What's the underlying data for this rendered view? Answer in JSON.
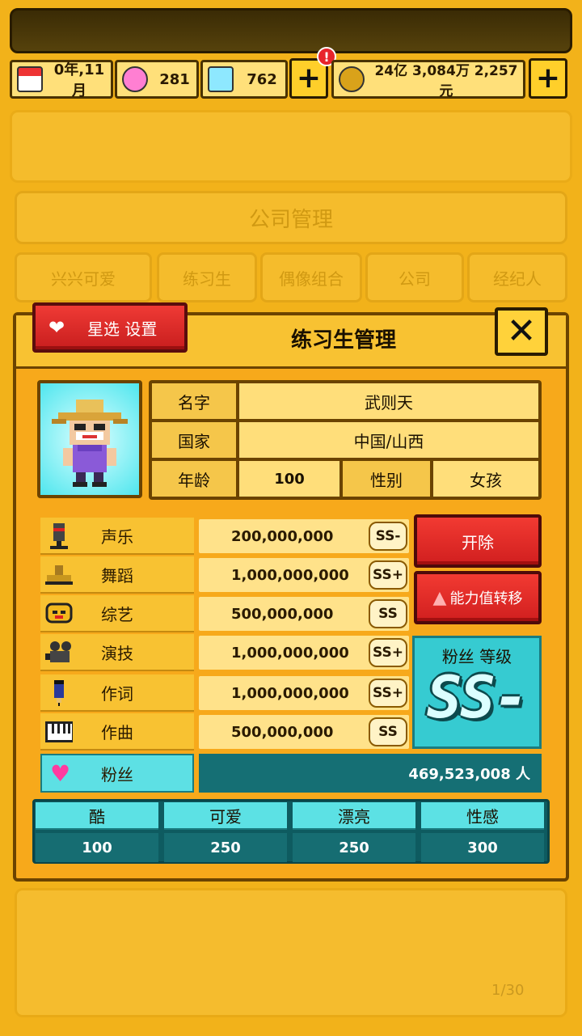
{
  "resources": {
    "date": "0年,11月",
    "pink_gems": "281",
    "diamonds": "762",
    "money": "24亿 3,084万 2,257元",
    "notification_mark": "!"
  },
  "icons": {
    "plus": "+",
    "close": "✕",
    "heart": "❤",
    "transfer": "▲",
    "fans": "♥"
  },
  "background": {
    "screen_title": "公司管理",
    "tabs": [
      "兴兴可爱",
      "练习生",
      "偶像组合",
      "公司",
      "经纪人"
    ],
    "page_indicator": "1/30"
  },
  "panel": {
    "title": "练习生管理",
    "star_button_label": "星选 设置"
  },
  "trainee": {
    "name_label": "名字",
    "name": "武则天",
    "country_label": "国家",
    "country": "中国/山西",
    "age_label": "年龄",
    "age": "100",
    "gender_label": "性别",
    "gender": "女孩"
  },
  "stats": [
    {
      "name": "声乐",
      "value": "200,000,000",
      "grade": "SS-",
      "icon": "mic-icon"
    },
    {
      "name": "舞蹈",
      "value": "1,000,000,000",
      "grade": "SS+",
      "icon": "shoe-icon"
    },
    {
      "name": "综艺",
      "value": "500,000,000",
      "grade": "SS",
      "icon": "mask-icon"
    },
    {
      "name": "演技",
      "value": "1,000,000,000",
      "grade": "SS+",
      "icon": "camera-icon"
    },
    {
      "name": "作词",
      "value": "1,000,000,000",
      "grade": "SS+",
      "icon": "pen-icon"
    },
    {
      "name": "作曲",
      "value": "500,000,000",
      "grade": "SS",
      "icon": "piano-icon"
    }
  ],
  "fans": {
    "label": "粉丝",
    "value": "469,523,008 人"
  },
  "actions": {
    "dismiss_label": "开除",
    "transfer_label": "能力值转移"
  },
  "fan_level": {
    "title": "粉丝 等级",
    "grade": "SS-"
  },
  "attributes": [
    {
      "label": "酷",
      "value": "100"
    },
    {
      "label": "可爱",
      "value": "250"
    },
    {
      "label": "漂亮",
      "value": "250"
    },
    {
      "label": "性感",
      "value": "300"
    }
  ],
  "colors": {
    "background": "#f2b21a",
    "red_button": "#e02a28",
    "teal": "#36cbd1",
    "dark_teal": "#156f74"
  }
}
